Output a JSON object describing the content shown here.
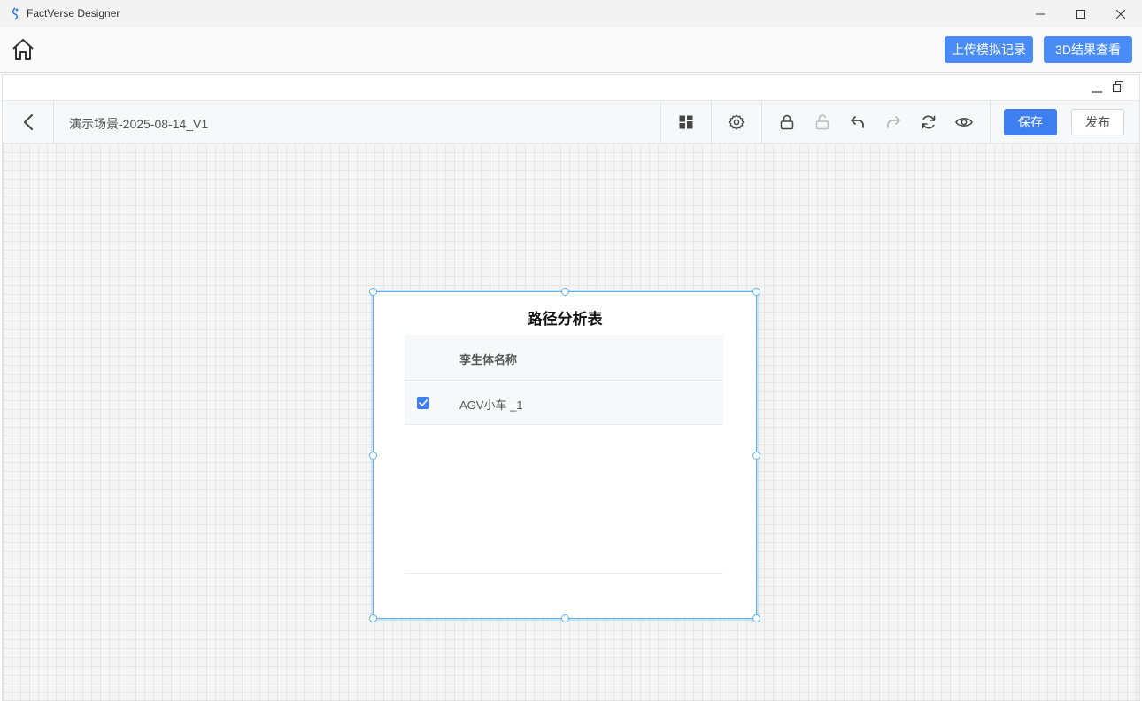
{
  "window": {
    "title": "FactVerse Designer",
    "minimize_icon": "minimize-icon",
    "maximize_icon": "maximize-icon",
    "close_icon": "close-icon"
  },
  "header": {
    "home_icon": "home-icon",
    "upload_label": "上传模拟记录",
    "view3d_label": "3D结果查看"
  },
  "toolbar": {
    "back_icon": "chevron-left-icon",
    "scene_name": "演示场景-2025-08-14_V1",
    "icons": [
      "layout-icon",
      "gear-icon",
      "lock-icon",
      "unlock-icon",
      "undo-icon",
      "redo-icon",
      "refresh-icon",
      "eye-icon"
    ],
    "save_label": "保存",
    "publish_label": "发布"
  },
  "widget": {
    "title": "路径分析表",
    "column_header": "孪生体名称",
    "rows": [
      {
        "checked": true,
        "label": "AGV小车 _1"
      }
    ]
  },
  "colors": {
    "accent": "#4a8cf7",
    "selection": "#5ab3f5"
  }
}
